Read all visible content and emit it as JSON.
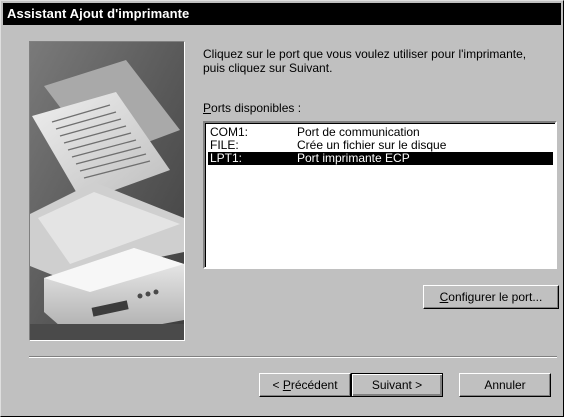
{
  "window": {
    "title": "Assistant Ajout d'imprimante"
  },
  "instruction": "Cliquez sur le port que vous voulez utiliser pour l'imprimante, puis cliquez sur Suivant.",
  "ports_label": {
    "pre": "",
    "accel": "P",
    "post": "orts disponibles :"
  },
  "ports": [
    {
      "port": "COM1:",
      "description": "Port de communication",
      "selected": false
    },
    {
      "port": "FILE:",
      "description": "Crée un fichier sur le disque",
      "selected": false
    },
    {
      "port": "LPT1:",
      "description": "Port imprimante ECP",
      "selected": true
    }
  ],
  "buttons": {
    "configure": {
      "pre": "",
      "accel": "C",
      "post": "onfigurer le port..."
    },
    "back": {
      "pre": "< ",
      "accel": "P",
      "post": "récédent"
    },
    "next": {
      "label": "Suivant >"
    },
    "cancel": {
      "label": "Annuler"
    }
  }
}
